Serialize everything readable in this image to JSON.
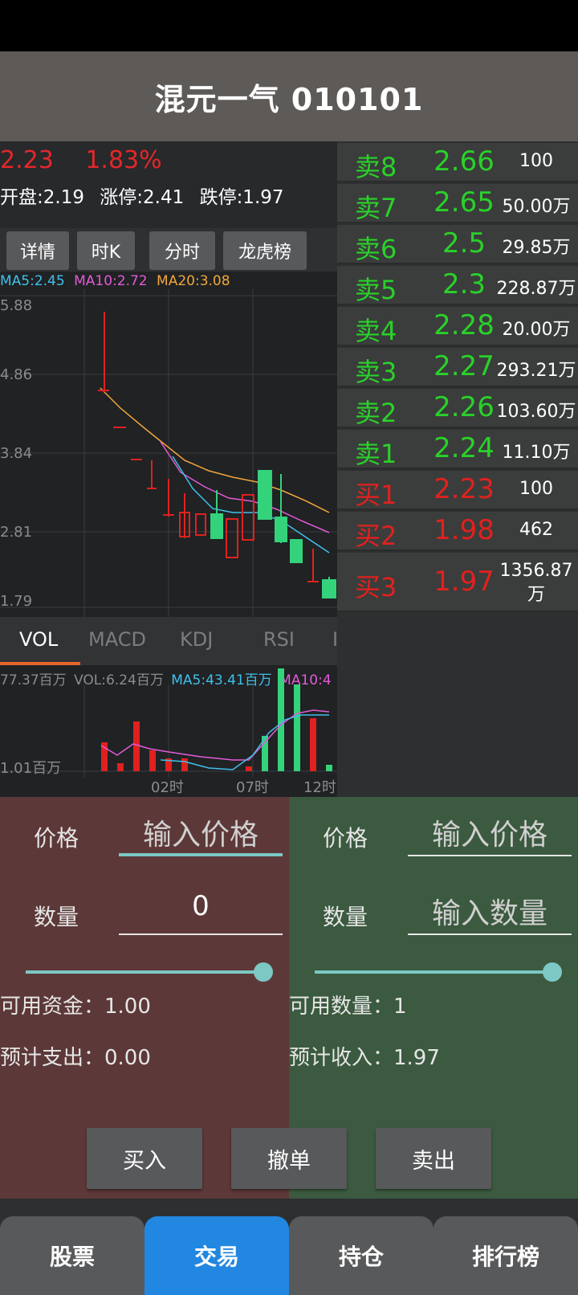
{
  "header": {
    "title": "混元一气 010101"
  },
  "quote": {
    "price": "2.23",
    "change_pct": "1.83%",
    "open": "开盘:2.19",
    "limit_up": "涨停:2.41",
    "limit_down": "跌停:1.97"
  },
  "chart_tabs": [
    "详情",
    "时K",
    "分时",
    "龙虎榜"
  ],
  "ma": {
    "ma5": "MA5:2.45",
    "ma10": "MA10:2.72",
    "ma20": "MA20:3.08"
  },
  "axis": {
    "y1": "5.88",
    "y2": "4.86",
    "y3": "3.84",
    "y4": "2.81",
    "y5": "1.79"
  },
  "indicator_tabs": [
    "VOL",
    "MACD",
    "KDJ",
    "RSI",
    "I"
  ],
  "vol_info": {
    "max": "77.37百万",
    "vol": "VOL:6.24百万",
    "ma5": "MA5:43.41百万",
    "ma10": "MA10:4",
    "min": "1.01百万"
  },
  "time_labels": [
    "02时",
    "07时",
    "12时"
  ],
  "order_book": [
    {
      "label": "卖8",
      "price": "2.66",
      "volume": "100",
      "side": "sell"
    },
    {
      "label": "卖7",
      "price": "2.65",
      "volume": "50.00万",
      "side": "sell"
    },
    {
      "label": "卖6",
      "price": "2.5",
      "volume": "29.85万",
      "side": "sell"
    },
    {
      "label": "卖5",
      "price": "2.3",
      "volume": "228.87万",
      "side": "sell"
    },
    {
      "label": "卖4",
      "price": "2.28",
      "volume": "20.00万",
      "side": "sell"
    },
    {
      "label": "卖3",
      "price": "2.27",
      "volume": "293.21万",
      "side": "sell"
    },
    {
      "label": "卖2",
      "price": "2.26",
      "volume": "103.60万",
      "side": "sell"
    },
    {
      "label": "卖1",
      "price": "2.24",
      "volume": "11.10万",
      "side": "sell"
    },
    {
      "label": "买1",
      "price": "2.23",
      "volume": "100",
      "side": "buy"
    },
    {
      "label": "买2",
      "price": "1.98",
      "volume": "462",
      "side": "buy"
    },
    {
      "label": "买3",
      "price": "1.97",
      "volume": "1356.87万",
      "side": "buy"
    }
  ],
  "buy_form": {
    "price_label": "价格",
    "price_placeholder": "输入价格",
    "qty_label": "数量",
    "qty_value": "0",
    "available_funds": "可用资金：1.00",
    "expected_cost": "预计支出：0.00"
  },
  "sell_form": {
    "price_label": "价格",
    "price_placeholder": "输入价格",
    "qty_label": "数量",
    "qty_placeholder": "输入数量",
    "available_qty": "可用数量：1",
    "expected_income": "预计收入：1.97"
  },
  "actions": {
    "buy": "买入",
    "cancel": "撤单",
    "sell": "卖出"
  },
  "nav": [
    "股票",
    "交易",
    "持仓",
    "排行榜"
  ],
  "colors": {
    "up": "#e0211f",
    "down": "#2ad12a",
    "accent": "#2287e0",
    "slider": "#7cc8c4"
  }
}
